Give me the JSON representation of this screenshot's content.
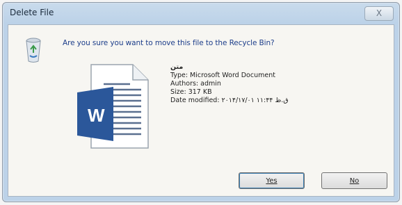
{
  "window": {
    "title": "Delete File",
    "close_label": "X"
  },
  "dialog": {
    "question": "Are you sure you want to move this file to the Recycle Bin?",
    "file": {
      "name": "متن",
      "type": "Type: Microsoft Word Document",
      "authors": "Authors: admin",
      "size": "Size: 317 KB",
      "date_modified": "Date modified: ۲۰۱۴/۱۷/۰۱ ق.ظ ۱۱:۴۴"
    },
    "icon_letter": "W",
    "buttons": {
      "yes": "Yes",
      "no": "No"
    }
  },
  "colors": {
    "word_blue": "#2b579a",
    "title_text": "#1b2b3c",
    "question_text": "#1d3e8a"
  }
}
